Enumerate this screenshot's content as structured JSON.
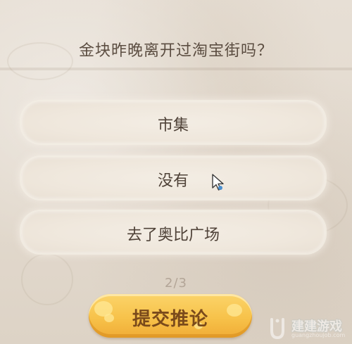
{
  "question": {
    "text": "金块昨晚离开过淘宝街吗？"
  },
  "options": [
    {
      "label": "市集"
    },
    {
      "label": "没有"
    },
    {
      "label": "去了奥比广场"
    }
  ],
  "page_indicator": "2/3",
  "submit_button": {
    "label": "提交推论"
  },
  "watermark": {
    "text": "建建游戏",
    "subtext": "guangzhoujob.com"
  },
  "colors": {
    "background": "#e5ddd2",
    "option_fill": "#efe7dc",
    "text": "#4f4238",
    "button_fill": "#f7c24a",
    "button_text": "#7a4a1b"
  }
}
